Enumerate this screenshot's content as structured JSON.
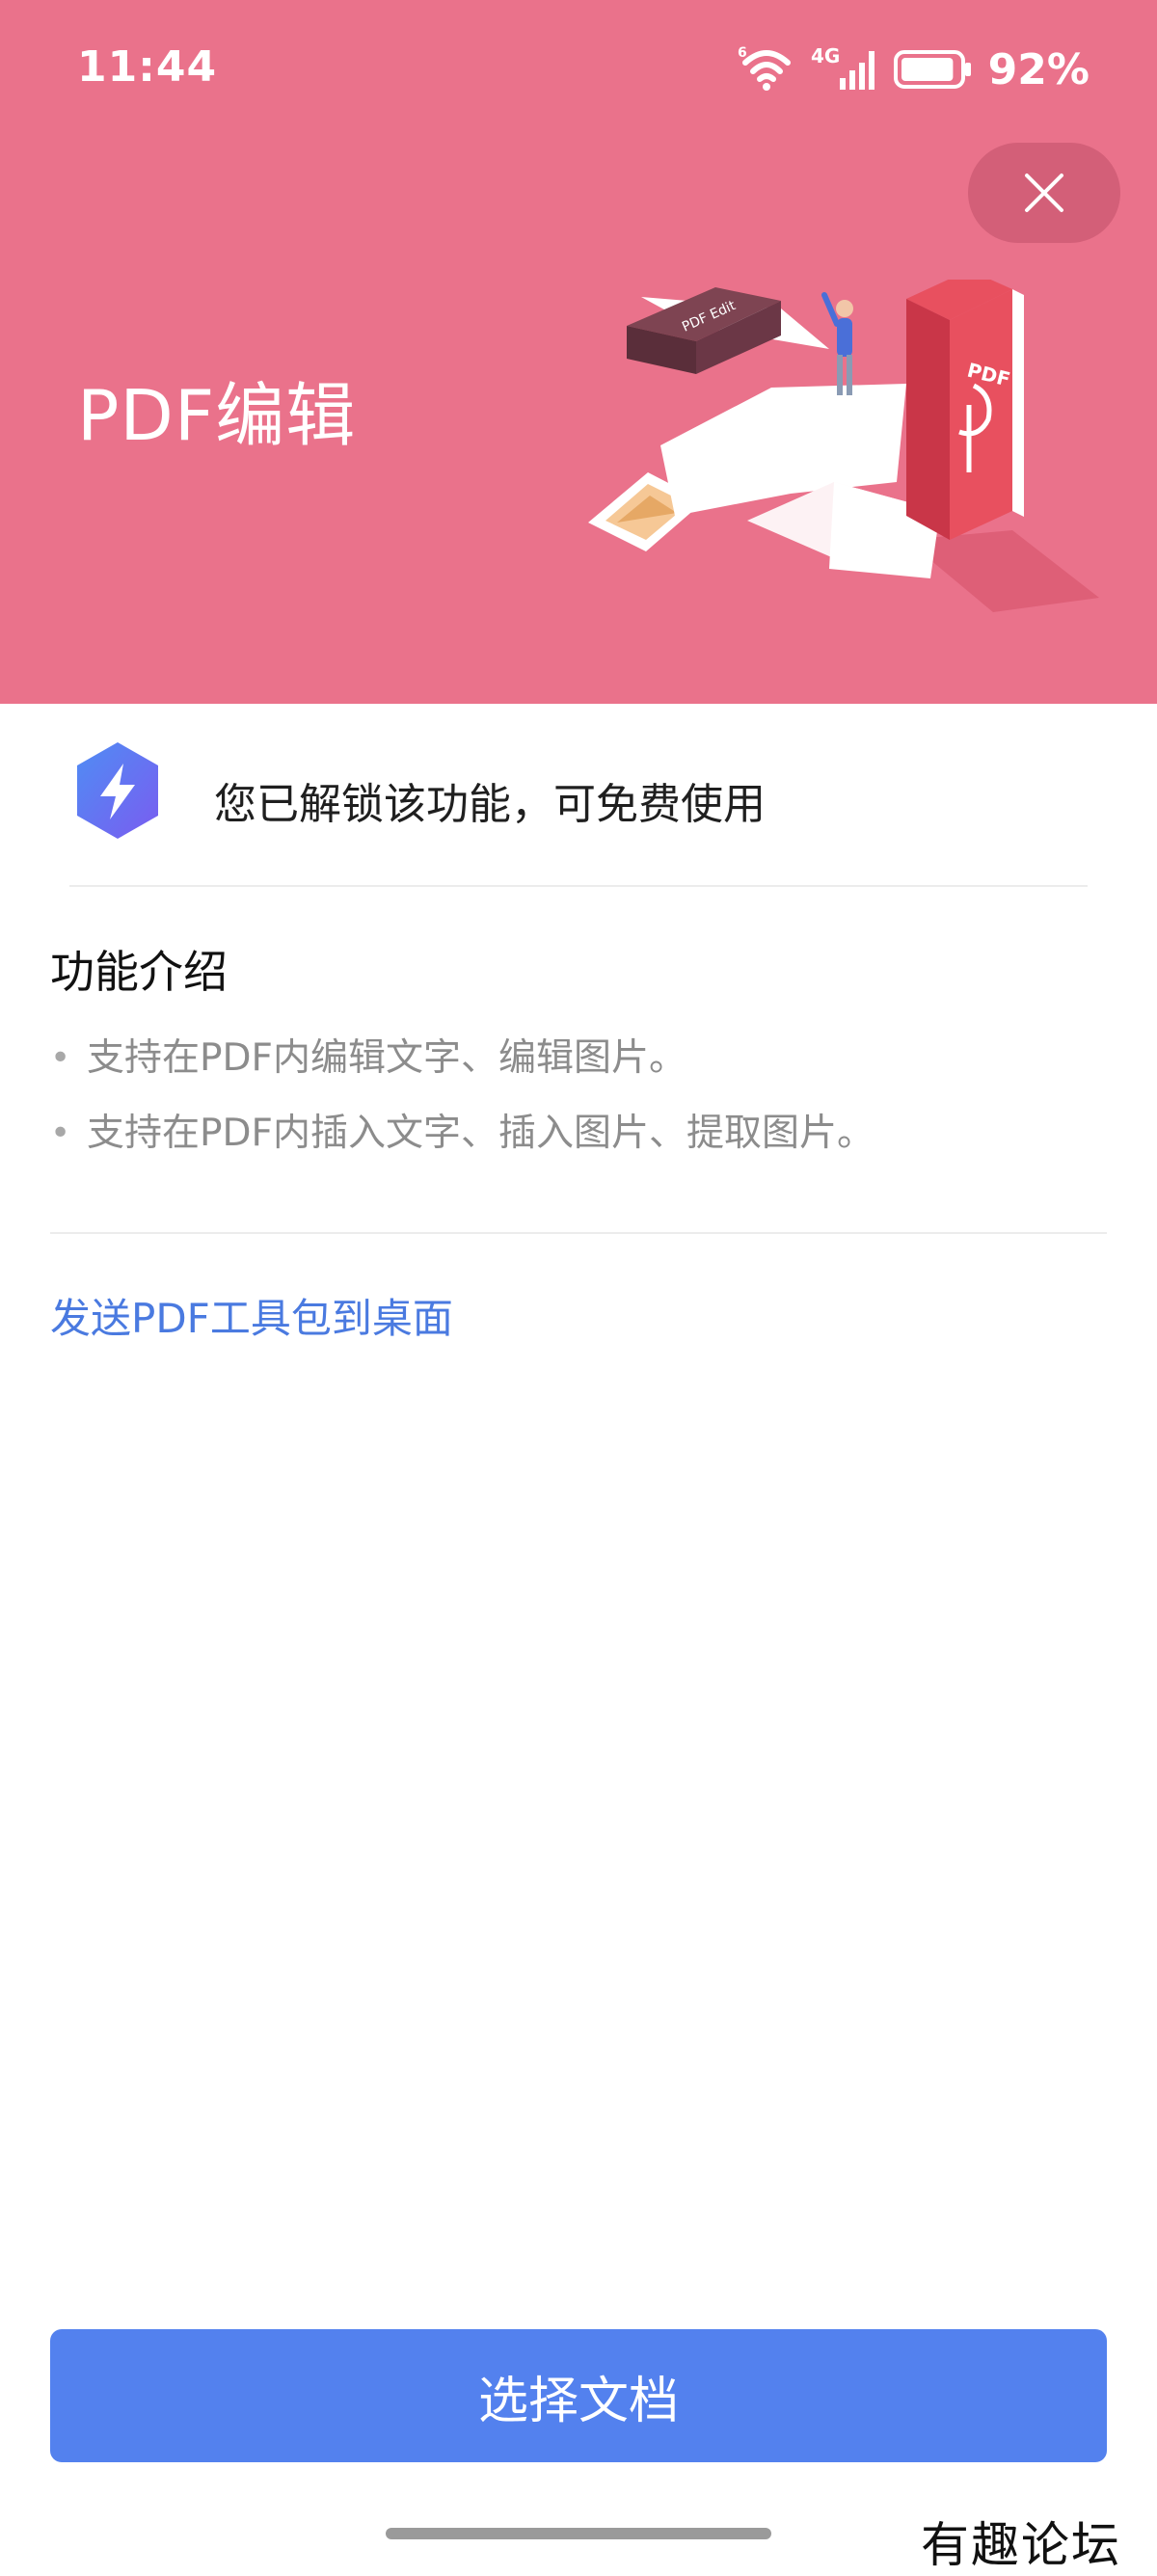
{
  "status_bar": {
    "time": "11:44",
    "wifi_badge": "6",
    "network_type": "4G",
    "battery_percent": "92%",
    "battery_level": 0.92
  },
  "header": {
    "title": "PDF编辑",
    "close_icon": "close-icon",
    "background_color": "#ea728b",
    "illustration_text": {
      "device_label": "PDF Edit",
      "book_label": "PDF"
    }
  },
  "unlock": {
    "icon": "lightning-bolt-icon",
    "text": "您已解锁该功能，可免费使用"
  },
  "intro": {
    "title": "功能介绍",
    "items": [
      {
        "bullet": "•",
        "text": "支持在PDF内编辑文字、编辑图片。"
      },
      {
        "bullet": "•",
        "text": "支持在PDF内插入文字、插入图片、提取图片。"
      }
    ]
  },
  "send_link": "发送PDF工具包到桌面",
  "primary_button": {
    "label": "选择文档",
    "color": "#5381ee"
  },
  "watermark": "有趣论坛"
}
